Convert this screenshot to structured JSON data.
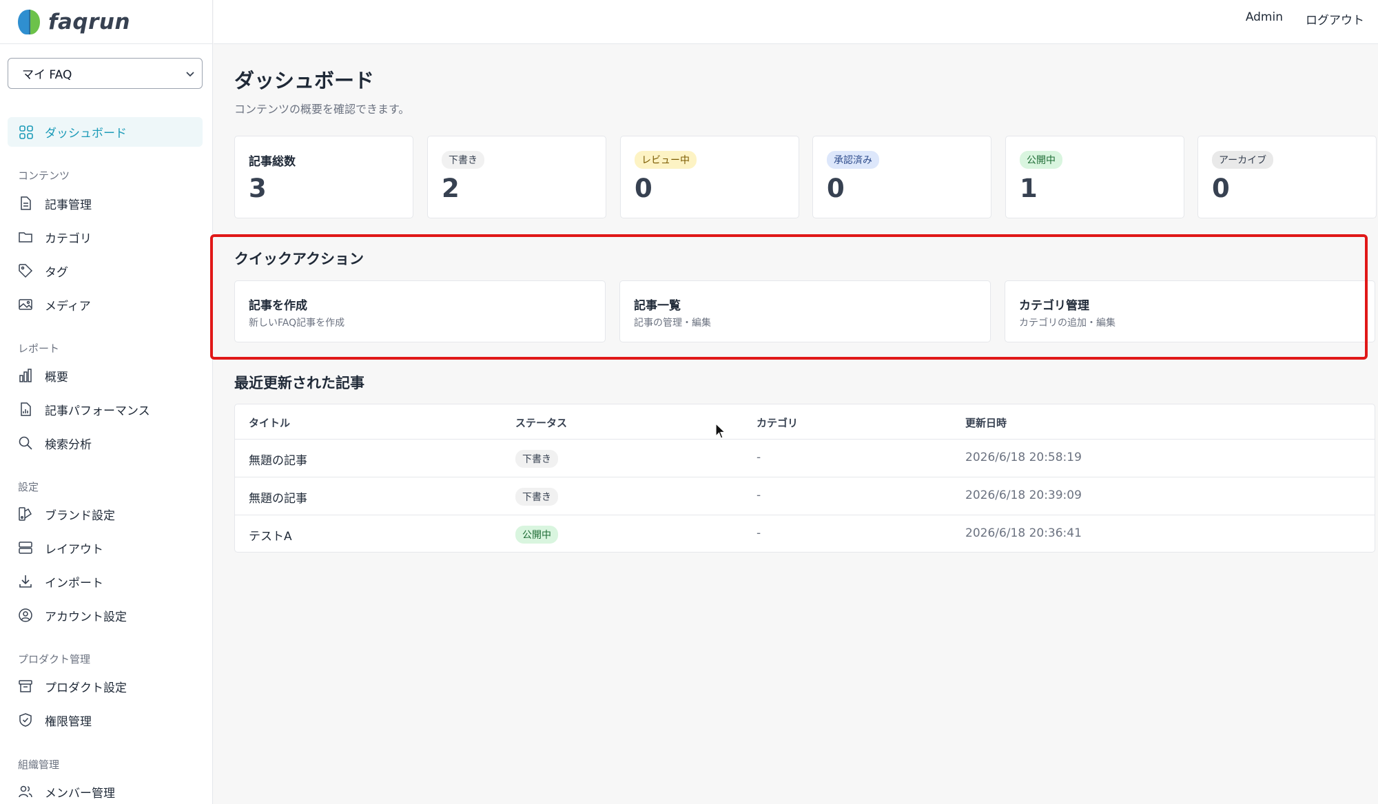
{
  "brand": {
    "name": "faqrun"
  },
  "sidebar": {
    "selector_value": "マイ FAQ",
    "active_item": "ダッシュボード",
    "sections": [
      {
        "label": "コンテンツ",
        "items": [
          "記事管理",
          "カテゴリ",
          "タグ",
          "メディア"
        ]
      },
      {
        "label": "レポート",
        "items": [
          "概要",
          "記事パフォーマンス",
          "検索分析"
        ]
      },
      {
        "label": "設定",
        "items": [
          "ブランド設定",
          "レイアウト",
          "インポート",
          "アカウント設定"
        ]
      },
      {
        "label": "プロダクト管理",
        "items": [
          "プロダクト設定",
          "権限管理"
        ]
      },
      {
        "label": "組織管理",
        "items": [
          "メンバー管理"
        ]
      }
    ]
  },
  "topbar": {
    "user": "Admin",
    "logout": "ログアウト"
  },
  "page": {
    "title": "ダッシュボード",
    "subtitle": "コンテンツの概要を確認できます。"
  },
  "stats": [
    {
      "label": "記事総数",
      "value": "3"
    },
    {
      "label": "下書き",
      "value": "2"
    },
    {
      "label": "レビュー中",
      "value": "0"
    },
    {
      "label": "承認済み",
      "value": "0"
    },
    {
      "label": "公開中",
      "value": "1"
    },
    {
      "label": "アーカイブ",
      "value": "0"
    }
  ],
  "quick_actions": {
    "title": "クイックアクション",
    "items": [
      {
        "title": "記事を作成",
        "desc": "新しいFAQ記事を作成"
      },
      {
        "title": "記事一覧",
        "desc": "記事の管理・編集"
      },
      {
        "title": "カテゴリ管理",
        "desc": "カテゴリの追加・編集"
      }
    ]
  },
  "recent": {
    "title": "最近更新された記事",
    "columns": [
      "タイトル",
      "ステータス",
      "カテゴリ",
      "更新日時"
    ],
    "rows": [
      {
        "title": "無題の記事",
        "status": "下書き",
        "category": "-",
        "updated": "2026/6/18 20:58:19"
      },
      {
        "title": "無題の記事",
        "status": "下書き",
        "category": "-",
        "updated": "2026/6/18 20:39:09"
      },
      {
        "title": "テストA",
        "status": "公開中",
        "category": "-",
        "updated": "2026/6/18 20:36:41"
      }
    ]
  },
  "colors": {
    "accent": "#1c9bb8",
    "highlight": "#e01818",
    "badge_draft_bg": "#f1f1f1",
    "badge_review_bg": "#fdf3c4",
    "badge_approved_bg": "#dde7fb",
    "badge_published_bg": "#d9f5df",
    "badge_archive_bg": "#e9e9e9"
  }
}
